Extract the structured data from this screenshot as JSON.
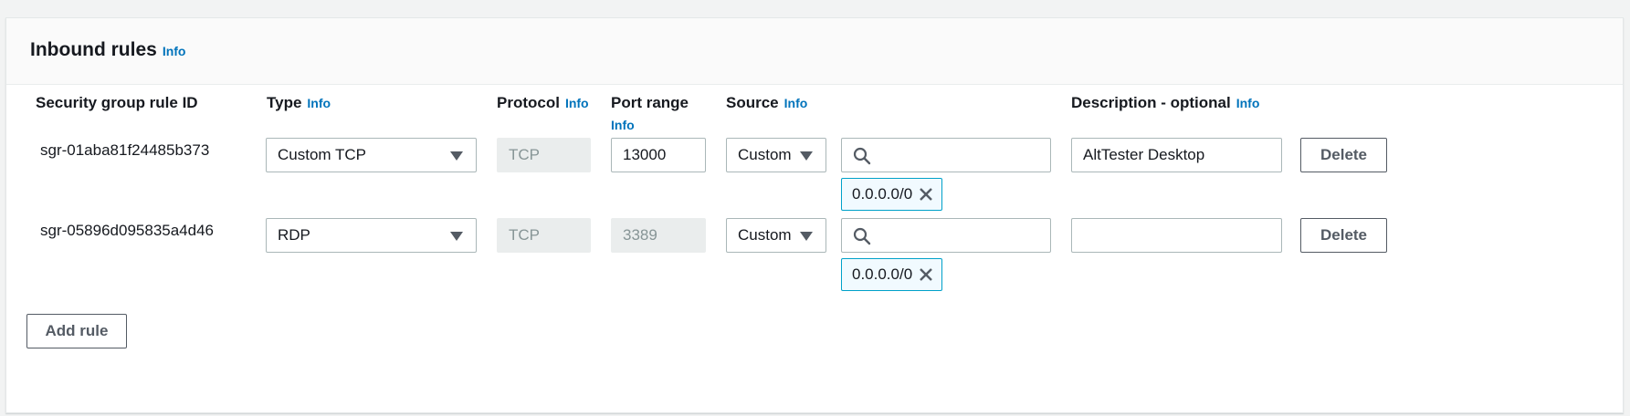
{
  "section": {
    "title": "Inbound rules",
    "info_label": "Info"
  },
  "columns": {
    "rule_id": "Security group rule ID",
    "type": "Type",
    "protocol": "Protocol",
    "port_range": "Port range",
    "source": "Source",
    "description": "Description - optional",
    "info_label": "Info"
  },
  "rules": [
    {
      "rule_id": "sgr-01aba81f24485b373",
      "type": "Custom TCP",
      "protocol": "TCP",
      "port_range": "13000",
      "source_type": "Custom",
      "source_search": "",
      "source_token": "0.0.0.0/0",
      "description": "AltTester Desktop",
      "delete_label": "Delete"
    },
    {
      "rule_id": "sgr-05896d095835a4d46",
      "type": "RDP",
      "protocol": "TCP",
      "port_range": "3389",
      "source_type": "Custom",
      "source_search": "",
      "source_token": "0.0.0.0/0",
      "description": "",
      "delete_label": "Delete"
    }
  ],
  "add_rule_label": "Add rule",
  "colors": {
    "link": "#0073bb",
    "token_border": "#00a1c9",
    "token_bg": "#f1faff",
    "disabled_bg": "#eaeded"
  },
  "icons": {
    "dropdown": "caret-down-icon",
    "search": "search-icon",
    "remove_token": "close-icon"
  }
}
